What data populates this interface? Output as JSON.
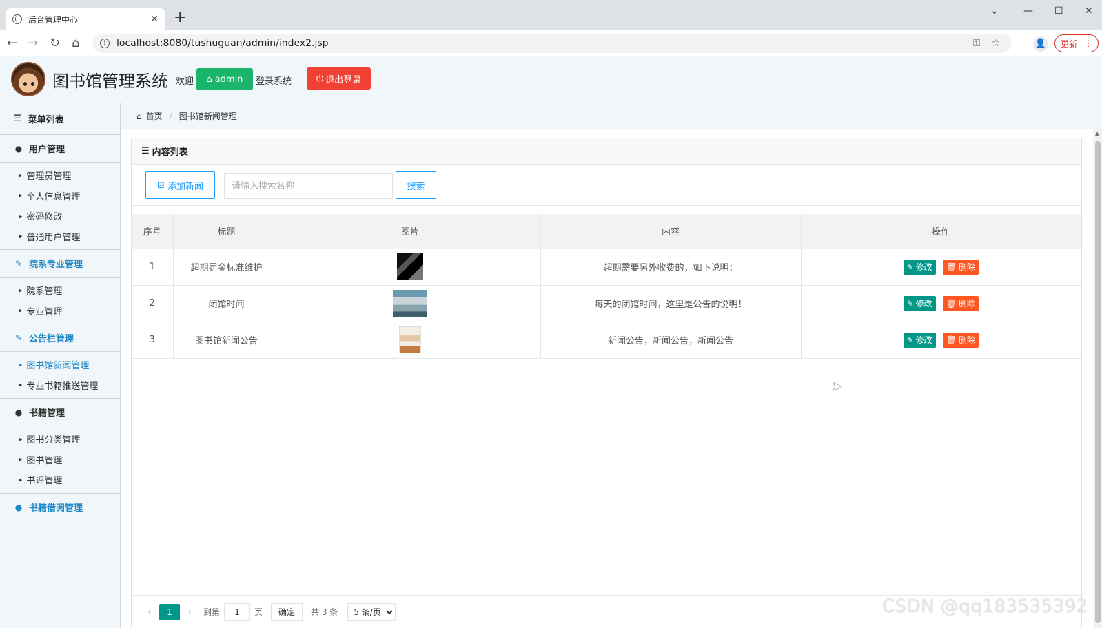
{
  "browser": {
    "tab_title": "后台管理中心",
    "tab_close": "✕",
    "new_tab": "+",
    "url": "localhost:8080/tushuguan/admin/index2.jsp",
    "update_label": "更新"
  },
  "header": {
    "system_title": "图书馆管理系统",
    "welcome": "欢迎",
    "user": "admin",
    "login_suffix": "登录系统",
    "logout": "退出登录"
  },
  "sidebar": {
    "title": "菜单列表",
    "groups": [
      {
        "label": "用户管理",
        "icon": "user-icon",
        "items": [
          "管理员管理",
          "个人信息管理",
          "密码修改",
          "普通用户管理"
        ]
      },
      {
        "label": "院系专业管理",
        "icon": "edit-icon",
        "items": [
          "院系管理",
          "专业管理"
        ]
      },
      {
        "label": "公告栏管理",
        "icon": "edit-icon",
        "items": [
          "图书馆新闻管理",
          "专业书籍推送管理"
        ]
      },
      {
        "label": "书籍管理",
        "icon": "user-icon",
        "items": [
          "图书分类管理",
          "图书管理",
          "书评管理"
        ]
      },
      {
        "label": "书籍借阅管理",
        "icon": "user-icon",
        "items": []
      }
    ],
    "active_item": "图书馆新闻管理"
  },
  "breadcrumb": {
    "home": "首页",
    "current": "图书馆新闻管理"
  },
  "panel": {
    "title": "内容列表",
    "add_button": "添加新闻",
    "search_placeholder": "请输入搜索名称",
    "search_button": "搜索"
  },
  "table": {
    "columns": [
      "序号",
      "标题",
      "图片",
      "内容",
      "操作"
    ],
    "rows": [
      {
        "index": "1",
        "title": "超期罚金标准维护",
        "image": "book-cover-dark",
        "content": "超期需要另外收费的，如下说明："
      },
      {
        "index": "2",
        "title": "闭馆时间",
        "image": "library-interior",
        "content": "每天的闭馆时间，这里是公告的说明！"
      },
      {
        "index": "3",
        "title": "图书馆新闻公告",
        "image": "book-cover-light",
        "content": "新闻公告，新闻公告，新闻公告"
      }
    ],
    "edit_label": "修改",
    "delete_label": "删除"
  },
  "pager": {
    "current_page": "1",
    "goto_label": "到第",
    "goto_value": "1",
    "page_label": "页",
    "confirm": "确定",
    "total": "共 3 条",
    "page_size": "5 条/页"
  },
  "watermark": "CSDN @qq183535392",
  "colors": {
    "admin_green": "#1ab56b",
    "logout_red": "#f04134",
    "edit_teal": "#009688",
    "delete_orange": "#ff5722",
    "link_blue": "#1e9fff",
    "sidebar_active": "#1e88c7"
  }
}
